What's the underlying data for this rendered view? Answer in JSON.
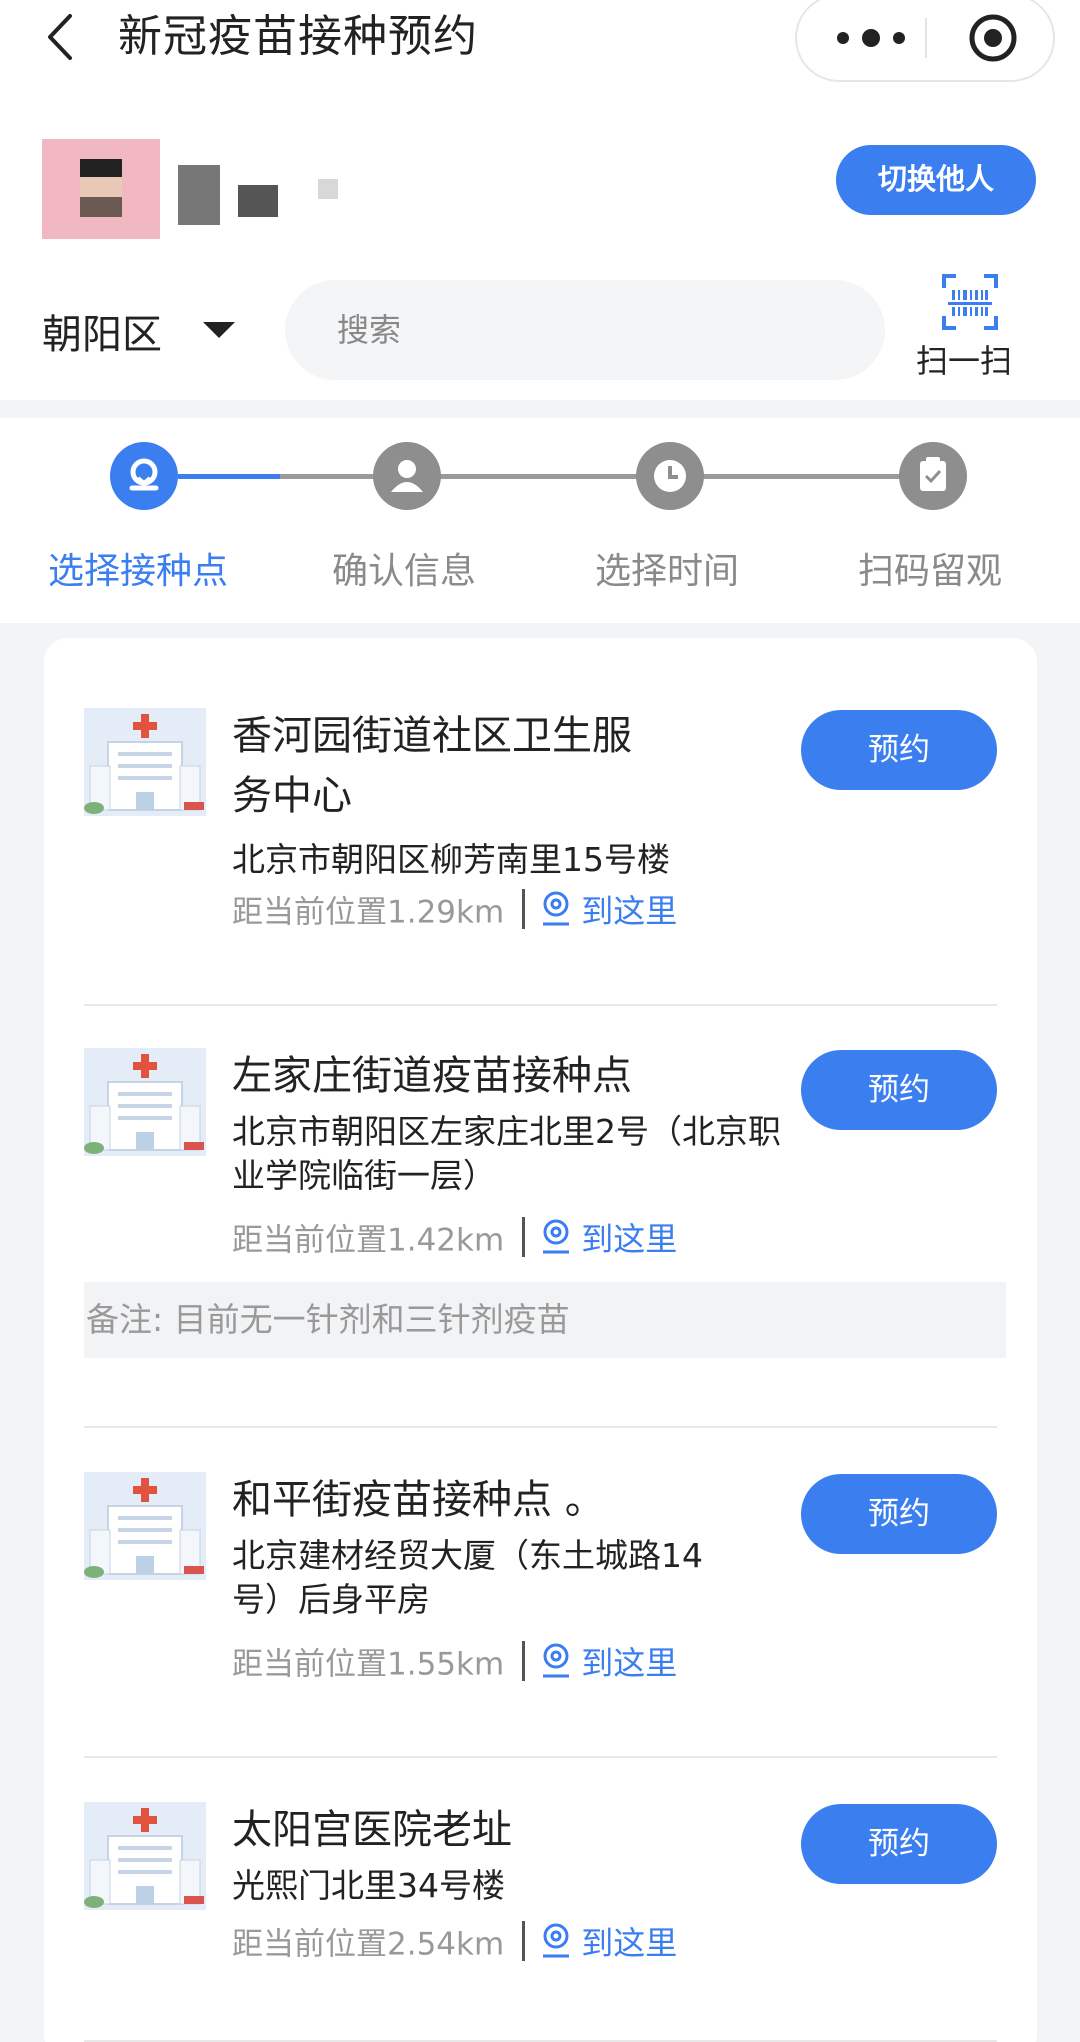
{
  "navbar": {
    "title": "新冠疫苗接种预约"
  },
  "user": {
    "switch_label": "切换他人"
  },
  "filter": {
    "district": "朝阳区",
    "search_placeholder": "搜索",
    "scan_label": "扫一扫"
  },
  "steps": [
    {
      "label": "选择接种点",
      "active": true
    },
    {
      "label": "确认信息",
      "active": false
    },
    {
      "label": "选择时间",
      "active": false
    },
    {
      "label": "扫码留观",
      "active": false
    }
  ],
  "sites": [
    {
      "name": "香河园街道社区卫生服务中心",
      "address": "北京市朝阳区柳芳南里15号楼",
      "distance": "距当前位置1.29km",
      "nav_label": "到这里",
      "book_label": "预约"
    },
    {
      "name": "左家庄街道疫苗接种点",
      "address": "北京市朝阳区左家庄北里2号（北京职业学院临街一层）",
      "distance": "距当前位置1.42km",
      "nav_label": "到这里",
      "book_label": "预约",
      "note": "备注: 目前无一针剂和三针剂疫苗"
    },
    {
      "name": "和平街疫苗接种点 。",
      "address": "北京建材经贸大厦（东土城路14号）后身平房",
      "distance": "距当前位置1.55km",
      "nav_label": "到这里",
      "book_label": "预约"
    },
    {
      "name": "太阳宫医院老址",
      "address": "光熙门北里34号楼",
      "distance": "距当前位置2.54km",
      "nav_label": "到这里",
      "book_label": "预约"
    }
  ],
  "colors": {
    "accent": "#3a7ef0",
    "inactive_step": "#8e8e8e"
  }
}
